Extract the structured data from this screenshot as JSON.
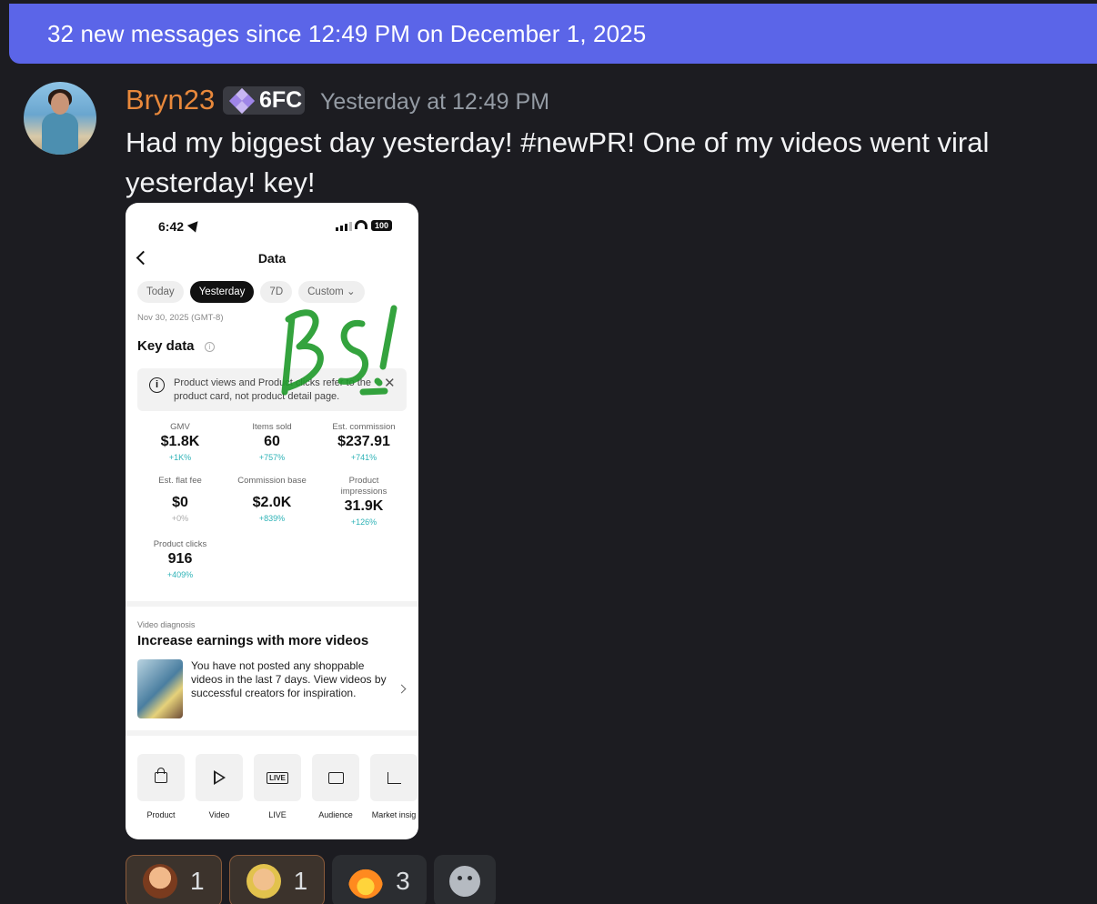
{
  "banner": {
    "text": "32 new messages since 12:49 PM on December 1, 2025"
  },
  "message": {
    "username": "Bryn23",
    "username_color": "#e8883b",
    "badge": "6FC",
    "timestamp": "Yesterday at 12:49 PM",
    "text": "Had my biggest day yesterday! #newPR! One of my videos went viral yesterday! key!"
  },
  "phone": {
    "status_time": "6:42",
    "battery": "100",
    "title": "Data",
    "tabs": [
      "Today",
      "Yesterday",
      "7D",
      "Custom"
    ],
    "active_tab": "Yesterday",
    "date": "Nov 30, 2025 (GMT-8)",
    "key_data_label": "Key data",
    "notice": "Product views and Product clicks refer to the product card, not product detail page.",
    "metrics": [
      {
        "label": "GMV",
        "value": "$1.8K",
        "change": "+1K%"
      },
      {
        "label": "Items sold",
        "value": "60",
        "change": "+757%"
      },
      {
        "label": "Est. commission",
        "value": "$237.91",
        "change": "+741%"
      },
      {
        "label": "Est. flat fee",
        "value": "$0",
        "change": "+0%"
      },
      {
        "label": "Commission base",
        "value": "$2.0K",
        "change": "+839%"
      },
      {
        "label": "Product impressions",
        "value": "31.9K",
        "change": "+126%"
      },
      {
        "label": "Product clicks",
        "value": "916",
        "change": "+409%"
      }
    ],
    "video_diagnosis_label": "Video diagnosis",
    "video_title": "Increase earnings with more videos",
    "video_text": "You have not posted any shoppable videos in the last 7 days. View videos by successful creators for inspiration.",
    "tools": [
      {
        "label": "Product",
        "icon": "shopping-bag-icon"
      },
      {
        "label": "Video",
        "icon": "play-icon"
      },
      {
        "label": "LIVE",
        "icon": "live-tv-icon"
      },
      {
        "label": "Audience",
        "icon": "id-card-icon"
      },
      {
        "label": "Market insig",
        "icon": "line-chart-icon"
      }
    ],
    "scribble_text": "BS!"
  },
  "reactions": [
    {
      "emoji": "avatar-emoji-bearded",
      "count": "1",
      "reacted": true
    },
    {
      "emoji": "avatar-emoji-blond",
      "count": "1",
      "reacted": true
    },
    {
      "emoji": "fire-emoji",
      "count": "3",
      "reacted": false
    }
  ],
  "colors": {
    "banner": "#5b65e8",
    "background": "#1c1c21",
    "change_positive": "#2fb3b7"
  }
}
